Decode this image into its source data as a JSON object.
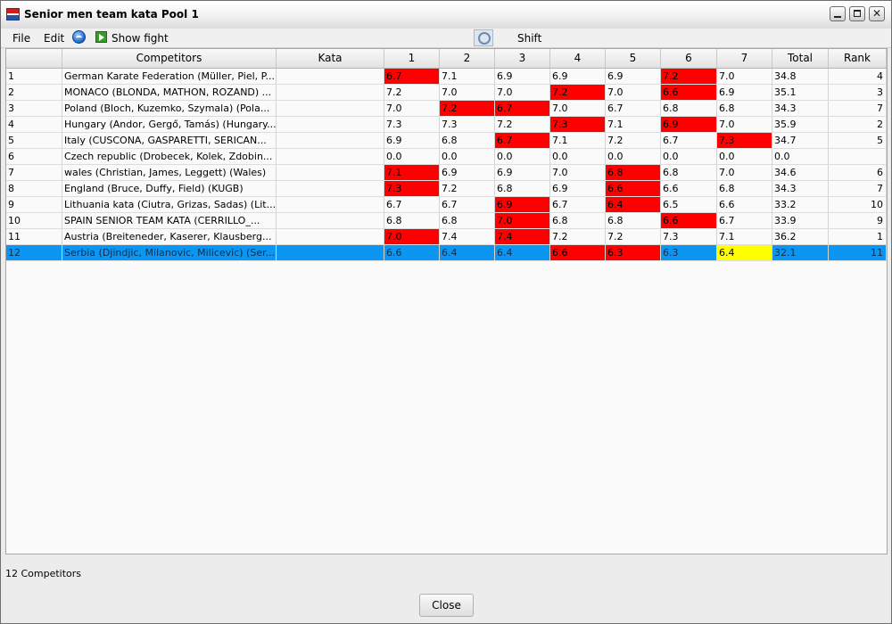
{
  "window": {
    "title": "Senior men team kata Pool 1",
    "app_icon_label": "SET",
    "close_glyph": "✕"
  },
  "menu": {
    "file": "File",
    "edit": "Edit"
  },
  "toolbar": {
    "show_fight": "Show fight",
    "shift": "Shift"
  },
  "table": {
    "columns": [
      "",
      "Competitors",
      "Kata",
      "1",
      "2",
      "3",
      "4",
      "5",
      "6",
      "7",
      "Total",
      "Rank"
    ],
    "rows": [
      {
        "no": "1",
        "competitors": "German Karate Federation (Müller, Piel, P...",
        "kata": "",
        "s1": "6.7",
        "s2": "7.1",
        "s3": "6.9",
        "s4": "6.9",
        "s5": "6.9",
        "s6": "7.2",
        "s7": "7.0",
        "total": "34.8",
        "rank": "4"
      },
      {
        "no": "2",
        "competitors": "MONACO (BLONDA, MATHON, ROZAND) ...",
        "kata": "",
        "s1": "7.2",
        "s2": "7.0",
        "s3": "7.0",
        "s4": "7.2",
        "s5": "7.0",
        "s6": "6.6",
        "s7": "6.9",
        "total": "35.1",
        "rank": "3"
      },
      {
        "no": "3",
        "competitors": "Poland (Bloch, Kuzemko, Szymala) (Pola...",
        "kata": "",
        "s1": "7.0",
        "s2": "7.2",
        "s3": "6.7",
        "s4": "7.0",
        "s5": "6.7",
        "s6": "6.8",
        "s7": "6.8",
        "total": "34.3",
        "rank": "7"
      },
      {
        "no": "4",
        "competitors": "Hungary (Andor, Gergő, Tamás) (Hungary...",
        "kata": "",
        "s1": "7.3",
        "s2": "7.3",
        "s3": "7.2",
        "s4": "7.3",
        "s5": "7.1",
        "s6": "6.9",
        "s7": "7.0",
        "total": "35.9",
        "rank": "2"
      },
      {
        "no": "5",
        "competitors": "Italy (CUSCONA, GASPARETTI, SERICAN...",
        "kata": "",
        "s1": "6.9",
        "s2": "6.8",
        "s3": "6.7",
        "s4": "7.1",
        "s5": "7.2",
        "s6": "6.7",
        "s7": "7.3",
        "total": "34.7",
        "rank": "5"
      },
      {
        "no": "6",
        "competitors": "Czech republic (Drobecek, Kolek, Zdobin...",
        "kata": "",
        "s1": "0.0",
        "s2": "0.0",
        "s3": "0.0",
        "s4": "0.0",
        "s5": "0.0",
        "s6": "0.0",
        "s7": "0.0",
        "total": "0.0",
        "rank": ""
      },
      {
        "no": "7",
        "competitors": "wales (Christian, James, Leggett) (Wales)",
        "kata": "",
        "s1": "7.1",
        "s2": "6.9",
        "s3": "6.9",
        "s4": "7.0",
        "s5": "6.8",
        "s6": "6.8",
        "s7": "7.0",
        "total": "34.6",
        "rank": "6"
      },
      {
        "no": "8",
        "competitors": "England (Bruce, Duffy, Field) (KUGB)",
        "kata": "",
        "s1": "7.3",
        "s2": "7.2",
        "s3": "6.8",
        "s4": "6.9",
        "s5": "6.6",
        "s6": "6.6",
        "s7": "6.8",
        "total": "34.3",
        "rank": "7"
      },
      {
        "no": "9",
        "competitors": "Lithuania kata (Ciutra, Grizas, Sadas) (Lit...",
        "kata": "",
        "s1": "6.7",
        "s2": "6.7",
        "s3": "6.9",
        "s4": "6.7",
        "s5": "6.4",
        "s6": "6.5",
        "s7": "6.6",
        "total": "33.2",
        "rank": "10"
      },
      {
        "no": "10",
        "competitors": "SPAIN SENIOR TEAM KATA (CERRILLO_...",
        "kata": "",
        "s1": "6.8",
        "s2": "6.8",
        "s3": "7.0",
        "s4": "6.8",
        "s5": "6.8",
        "s6": "6.6",
        "s7": "6.7",
        "total": "33.9",
        "rank": "9"
      },
      {
        "no": "11",
        "competitors": "Austria (Breiteneder, Kaserer, Klausberg...",
        "kata": "",
        "s1": "7.0",
        "s2": "7.4",
        "s3": "7.4",
        "s4": "7.2",
        "s5": "7.2",
        "s6": "7.3",
        "s7": "7.1",
        "total": "36.2",
        "rank": "1"
      },
      {
        "no": "12",
        "competitors": "Serbia  (Djindjic, Milanovic, Milicevic) (Ser...",
        "kata": "",
        "s1": "6.6",
        "s2": "6.4",
        "s3": "6.4",
        "s4": "6.6",
        "s5": "6.3",
        "s6": "6.3",
        "s7": "6.4",
        "total": "32.1",
        "rank": "11"
      }
    ]
  },
  "status": {
    "count_text": "12 Competitors"
  },
  "buttons": {
    "close": "Close"
  },
  "colors": {
    "highlight_red": "#ff0000",
    "highlight_yellow": "#ffff00",
    "selection_blue": "#0b97f1"
  }
}
